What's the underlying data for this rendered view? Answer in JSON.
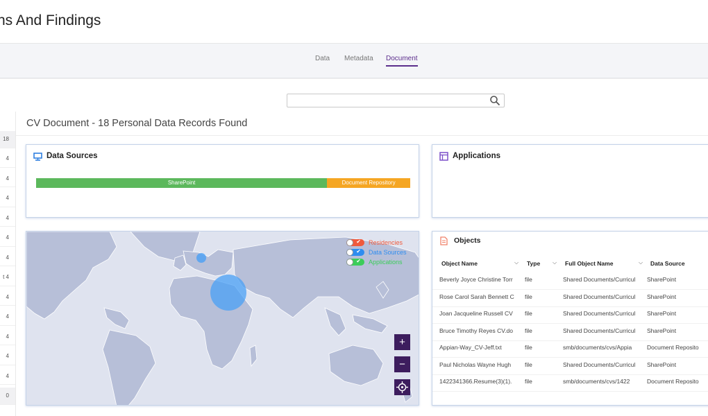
{
  "page": {
    "title": "ns And Findings"
  },
  "tabs": [
    {
      "label": "Data",
      "active": false
    },
    {
      "label": "Metadata",
      "active": false
    },
    {
      "label": "Document",
      "active": true
    }
  ],
  "search": {
    "placeholder": "",
    "value": "",
    "icon": "search-icon"
  },
  "left_column": {
    "values": [
      "18",
      "4",
      "4",
      "4",
      "4",
      "4",
      "4",
      "t 4",
      "4",
      "4",
      "4",
      "4",
      "4",
      "0"
    ]
  },
  "section": {
    "title": "CV Document - 18 Personal Data Records Found"
  },
  "data_sources": {
    "title": "Data Sources",
    "icon": "monitor-icon",
    "segments": [
      {
        "label": "SharePoint",
        "value": 14,
        "color": "#5cb85c"
      },
      {
        "label": "Document Repository",
        "value": 4,
        "color": "#f5a623"
      }
    ]
  },
  "applications": {
    "title": "Applications",
    "icon": "window-icon"
  },
  "map": {
    "legend": [
      {
        "label": "Residencies",
        "color": "#f05a3c"
      },
      {
        "label": "Data Sources",
        "color": "#2e8df0"
      },
      {
        "label": "Applications",
        "color": "#3ccd5a"
      }
    ],
    "zoom_in": "+",
    "zoom_out": "−",
    "locate_icon": "crosshair-icon"
  },
  "objects": {
    "title": "Objects",
    "icon": "document-icon",
    "columns": [
      "Object Name",
      "Type",
      "Full Object Name",
      "Data Source"
    ],
    "rows": [
      [
        "Beverly Joyce Christine Torr",
        "file",
        "Shared Documents/Curricul",
        "SharePoint"
      ],
      [
        "Rose Carol Sarah Bennett C",
        "file",
        "Shared Documents/Curricul",
        "SharePoint"
      ],
      [
        "Joan Jacqueline Russell CV",
        "file",
        "Shared Documents/Curricul",
        "SharePoint"
      ],
      [
        "Bruce Timothy Reyes CV.do",
        "file",
        "Shared Documents/Curricul",
        "SharePoint"
      ],
      [
        "Appian-Way_CV-Jeff.txt",
        "file",
        "smb/documents/cvs/Appia",
        "Document Reposito"
      ],
      [
        "Paul Nicholas Wayne Hugh",
        "file",
        "Shared Documents/Curricul",
        "SharePoint"
      ],
      [
        "1422341366.Resume(3)(1).",
        "file",
        "smb/documents/cvs/1422",
        "Document Reposito"
      ]
    ]
  }
}
